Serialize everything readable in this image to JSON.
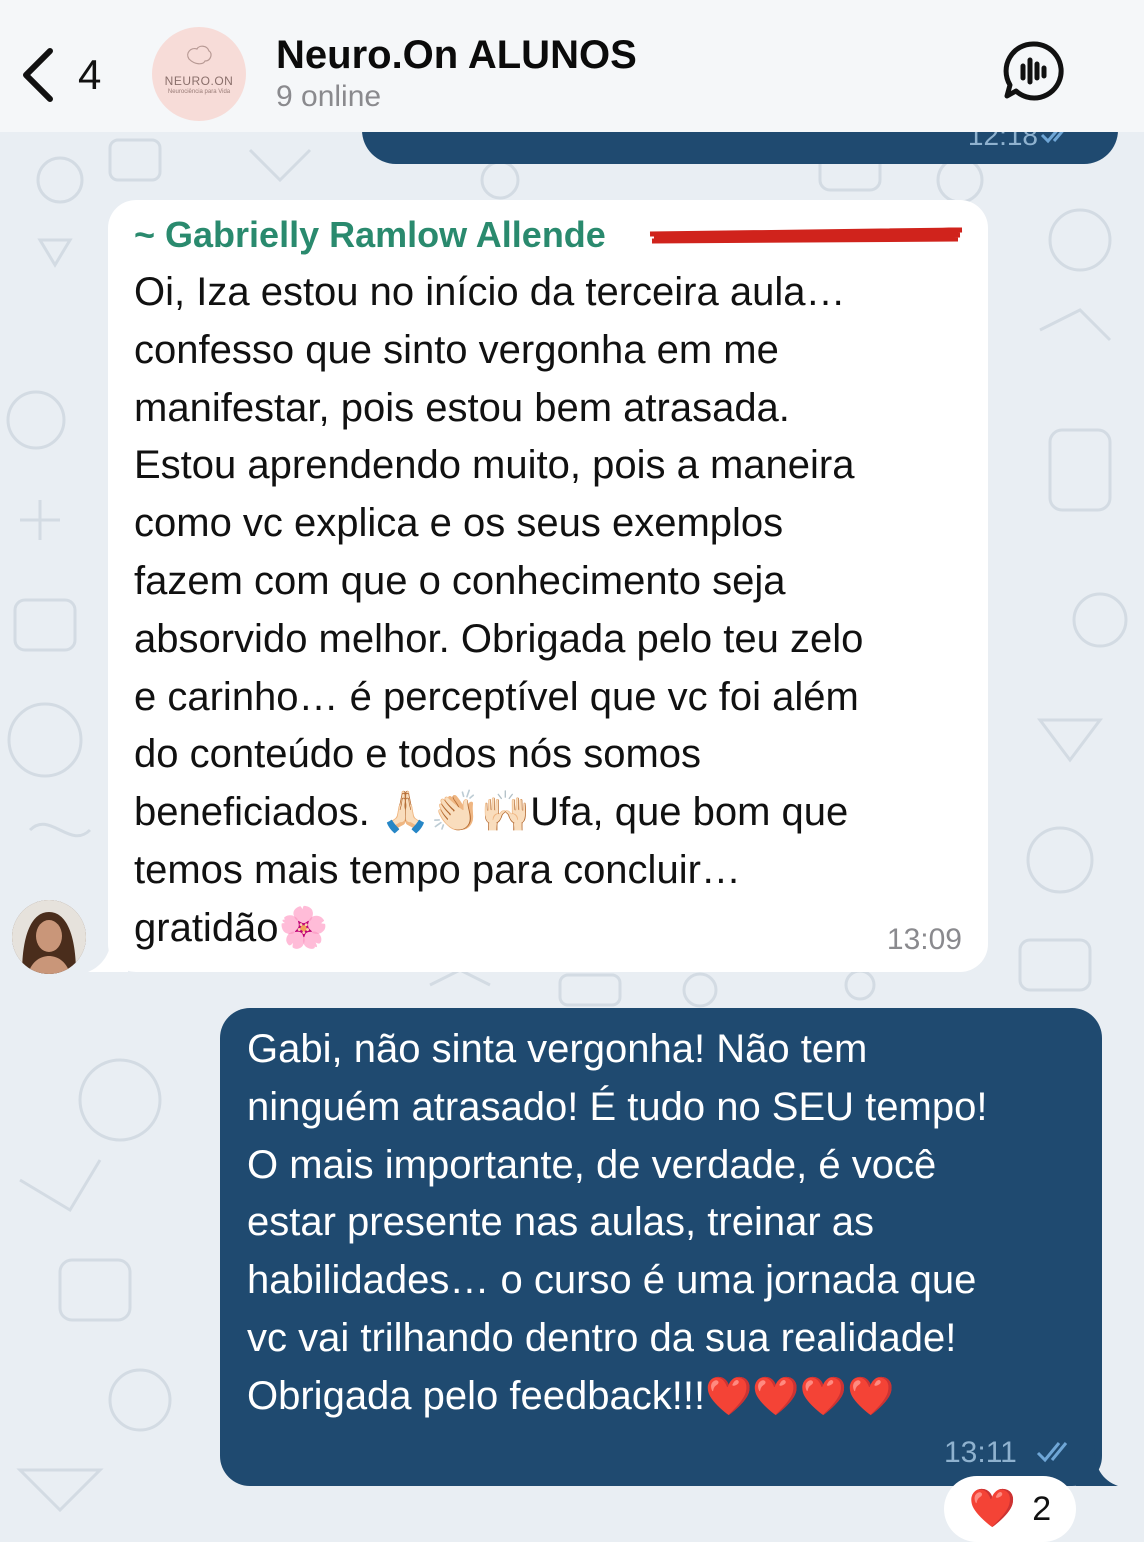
{
  "header": {
    "back_count": "4",
    "title": "Neuro.On ALUNOS",
    "subtitle": "9 online",
    "avatar_logo": "NEURO.ON",
    "avatar_tagline": "Neurociência para Vida"
  },
  "previous_message": {
    "time": "12:18"
  },
  "incoming_message": {
    "sender": "~ Gabrielly Ramlow Allende",
    "text": "Oi, Iza estou no início da terceira aula…\nconfesso que sinto vergonha em me\nmanifestar, pois estou bem atrasada.\nEstou aprendendo muito, pois a maneira\ncomo vc explica e os seus exemplos\nfazem com que o conhecimento seja\nabsorvido melhor. Obrigada pelo teu zelo\ne carinho… é perceptível que vc foi além\ndo conteúdo e todos nós somos\nbeneficiados. 🙏🏻👏🏻🙌🏻Ufa, que bom que\ntemos mais tempo para concluir…\ngratidão🌸",
    "time": "13:09"
  },
  "outgoing_message": {
    "text": "Gabi, não sinta vergonha! Não tem\nninguém atrasado! É tudo no SEU tempo!\nO mais importante, de verdade, é você\nestar presente nas aulas, treinar as\nhabilidades… o curso é uma jornada que\nvc vai trilhando dentro da sua realidade!\nObrigada pelo feedback!!!",
    "hearts": "❤️❤️❤️❤️",
    "time": "13:11"
  },
  "reaction": {
    "emoji": "❤️",
    "count": "2"
  },
  "colors": {
    "outgoing_bubble": "#1f4a70",
    "incoming_bubble": "#ffffff",
    "sender_name": "#2a8a6e",
    "background": "#e9eef3"
  },
  "icons": [
    "chevron-left-icon",
    "voice-chat-icon",
    "double-check-icon",
    "brain-logo-icon"
  ]
}
